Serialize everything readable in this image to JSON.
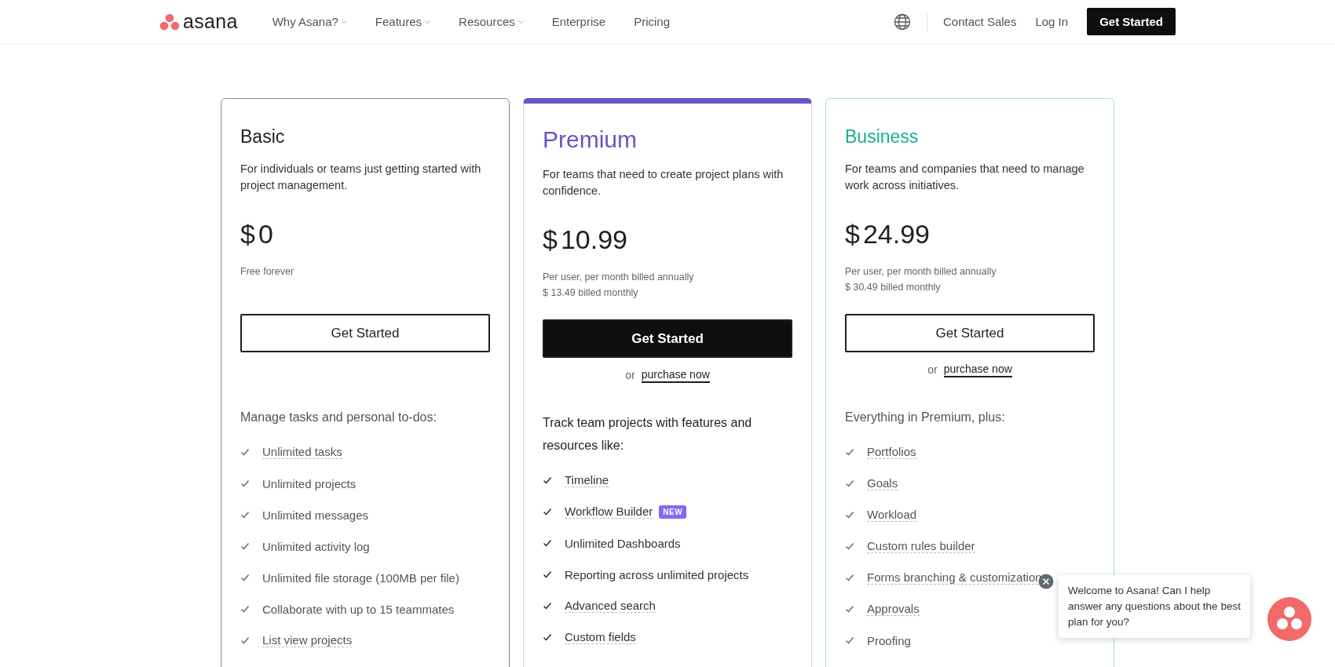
{
  "header": {
    "logo": "asana",
    "nav": [
      {
        "label": "Why Asana?",
        "dropdown": true
      },
      {
        "label": "Features",
        "dropdown": true
      },
      {
        "label": "Resources",
        "dropdown": true
      },
      {
        "label": "Enterprise",
        "dropdown": false
      },
      {
        "label": "Pricing",
        "dropdown": false
      }
    ],
    "links": [
      "Contact Sales",
      "Log In"
    ],
    "cta": "Get Started"
  },
  "plans": [
    {
      "name": "Basic",
      "color": "#1e1f21",
      "featured": false,
      "description": "For individuals or teams just getting started with project management.",
      "currency": "$",
      "price": "0",
      "notes": [
        "Free forever"
      ],
      "button": {
        "label": "Get Started",
        "filled": false
      },
      "features_heading": "Manage tasks and personal to-dos:",
      "features": [
        {
          "label": "Unlimited tasks",
          "underlined": true
        },
        {
          "label": "Unlimited projects",
          "underlined": false
        },
        {
          "label": "Unlimited messages",
          "underlined": false
        },
        {
          "label": "Unlimited activity log",
          "underlined": false
        },
        {
          "label": "Unlimited file storage (100MB per file)",
          "underlined": false
        },
        {
          "label": "Collaborate with up to 15 teammates",
          "underlined": false
        },
        {
          "label": "List view projects",
          "underlined": true
        }
      ]
    },
    {
      "name": "Premium",
      "color": "#6457c6",
      "featured": true,
      "description": "For teams that need to create project plans with confidence.",
      "currency": "$",
      "price": "10.99",
      "notes": [
        "Per user, per month billed annually",
        "$ 13.49 billed monthly"
      ],
      "button": {
        "label": "Get Started",
        "filled": true
      },
      "or": "or",
      "purchase": "purchase now",
      "features_heading": "Track team projects with features and resources like:",
      "features": [
        {
          "label": "Timeline",
          "underlined": true
        },
        {
          "label": "Workflow Builder",
          "underlined": true,
          "badge": "NEW"
        },
        {
          "label": "Unlimited Dashboards",
          "underlined": false
        },
        {
          "label": "Reporting across unlimited projects",
          "underlined": false
        },
        {
          "label": "Advanced search",
          "underlined": true
        },
        {
          "label": "Custom fields",
          "underlined": true
        }
      ]
    },
    {
      "name": "Business",
      "color": "#1aae98",
      "featured": false,
      "description": "For teams and companies that need to manage work across initiatives.",
      "currency": "$",
      "price": "24.99",
      "notes": [
        "Per user, per month billed annually",
        "$ 30.49 billed monthly"
      ],
      "button": {
        "label": "Get Started",
        "filled": false
      },
      "or": "or",
      "purchase": "purchase now",
      "features_heading": "Everything in Premium, plus:",
      "features": [
        {
          "label": "Portfolios",
          "underlined": true
        },
        {
          "label": "Goals",
          "underlined": true
        },
        {
          "label": "Workload",
          "underlined": true
        },
        {
          "label": "Custom rules builder",
          "underlined": true
        },
        {
          "label": "Forms branching & customization",
          "underlined": true
        },
        {
          "label": "Approvals",
          "underlined": true
        },
        {
          "label": "Proofing",
          "underlined": false
        }
      ]
    }
  ],
  "chat": {
    "message": "Welcome to Asana! Can I help answer any questions about the best plan for you?"
  }
}
